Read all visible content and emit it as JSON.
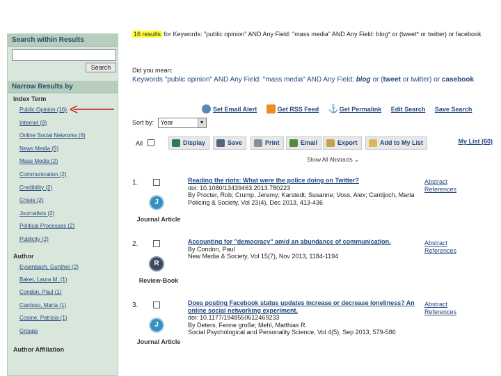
{
  "sidebar": {
    "search_heading": "Search within Results",
    "search_input_value": "",
    "search_button": "Search",
    "narrow_heading": "Narrow Results by",
    "index_term_heading": "Index Term",
    "index_terms": [
      "Public Opinion (16)",
      "Internet (9)",
      "Online Social Networks (6)",
      "News Media (5)",
      "Mass Media (2)",
      "Communication (2)",
      "Credibility (2)",
      "Crises (2)",
      "Journalists (2)",
      "Political Processes (2)",
      "Publicity (2)"
    ],
    "author_heading": "Author",
    "authors": [
      "Eysenbach, Gunther (2)",
      "Baker, Laura M. (1)",
      "Condon, Paul (1)",
      "Cardoso, Marta (1)",
      "Cosme, Patricia (1)",
      "Groups"
    ],
    "affiliation_heading": "Author Affiliation"
  },
  "header": {
    "result_count": "16 results",
    "query_text": "for Keywords: \"public opinion\" AND Any Field: \"mass media\" AND Any Field: blog* or (tweet* or twitter) or facebook",
    "did_you_mean_label": "Did you mean:",
    "suggestion_prefix": "Keywords \"public opinion\" AND Any Field: \"mass media\" AND Any Field: ",
    "suggestion_bold1": "blog",
    "suggestion_mid": " or (",
    "suggestion_bold2": "tweet",
    "suggestion_tail": " or twitter) or ",
    "suggestion_bold3": "casebook"
  },
  "actions": {
    "email_alert": "Set Email Alert",
    "rss_feed": "Get RSS Feed",
    "permalink": "Get Permalink",
    "edit_search": "Edit Search",
    "save_search": "Save Search"
  },
  "sort": {
    "label": "Sort by:",
    "value": "Year"
  },
  "toolbar": {
    "all_label": "All",
    "display": "Display",
    "save": "Save",
    "print": "Print",
    "email": "Email",
    "export": "Export",
    "add_to_list": "Add to My List",
    "my_list": "My List (60)",
    "show_abstracts": "Show All Abstracts"
  },
  "results": [
    {
      "number": "1.",
      "title": "Reading the riots: What were the police doing on Twitter?",
      "doi": "doi: 10.1080/13439463.2013.780223",
      "authors": "By Procter, Rob; Crump, Jeremy; Karstedt, Susanne; Voss, Alex; Cantijoch, Marta",
      "source": "Policing & Society, Vol 23(4), Dec 2013, 413-436",
      "type": "Journal Article",
      "link1": "Abstract",
      "link2": "References"
    },
    {
      "number": "2.",
      "title": "Accounting for \"democracy\" amid an abundance of communication.",
      "doi": "",
      "authors": "By Condon, Paul",
      "source": "New Media & Society, Vol 15(7), Nov 2013, 1184-1194",
      "type": "Review-Book",
      "link1": "Abstract",
      "link2": "References"
    },
    {
      "number": "3.",
      "title": "Does posting Facebook status updates increase or decrease loneliness? An online social networking experiment.",
      "doi": "doi: 10.1177/1948550612469233",
      "authors": "By Deters, Fenne große; Mehl, Matthias R.",
      "source": "Social Psychological and Personality Science, Vol 4(5), Sep 2013, 579-586",
      "type": "Journal Article",
      "link1": "Abstract",
      "link2": "References"
    }
  ],
  "colors": {
    "link": "#23477e",
    "highlight": "#ffff33",
    "sidebar_bg": "#d9e6dc",
    "sidebar_head": "#b7cdbd",
    "arrow": "#cc1111"
  }
}
